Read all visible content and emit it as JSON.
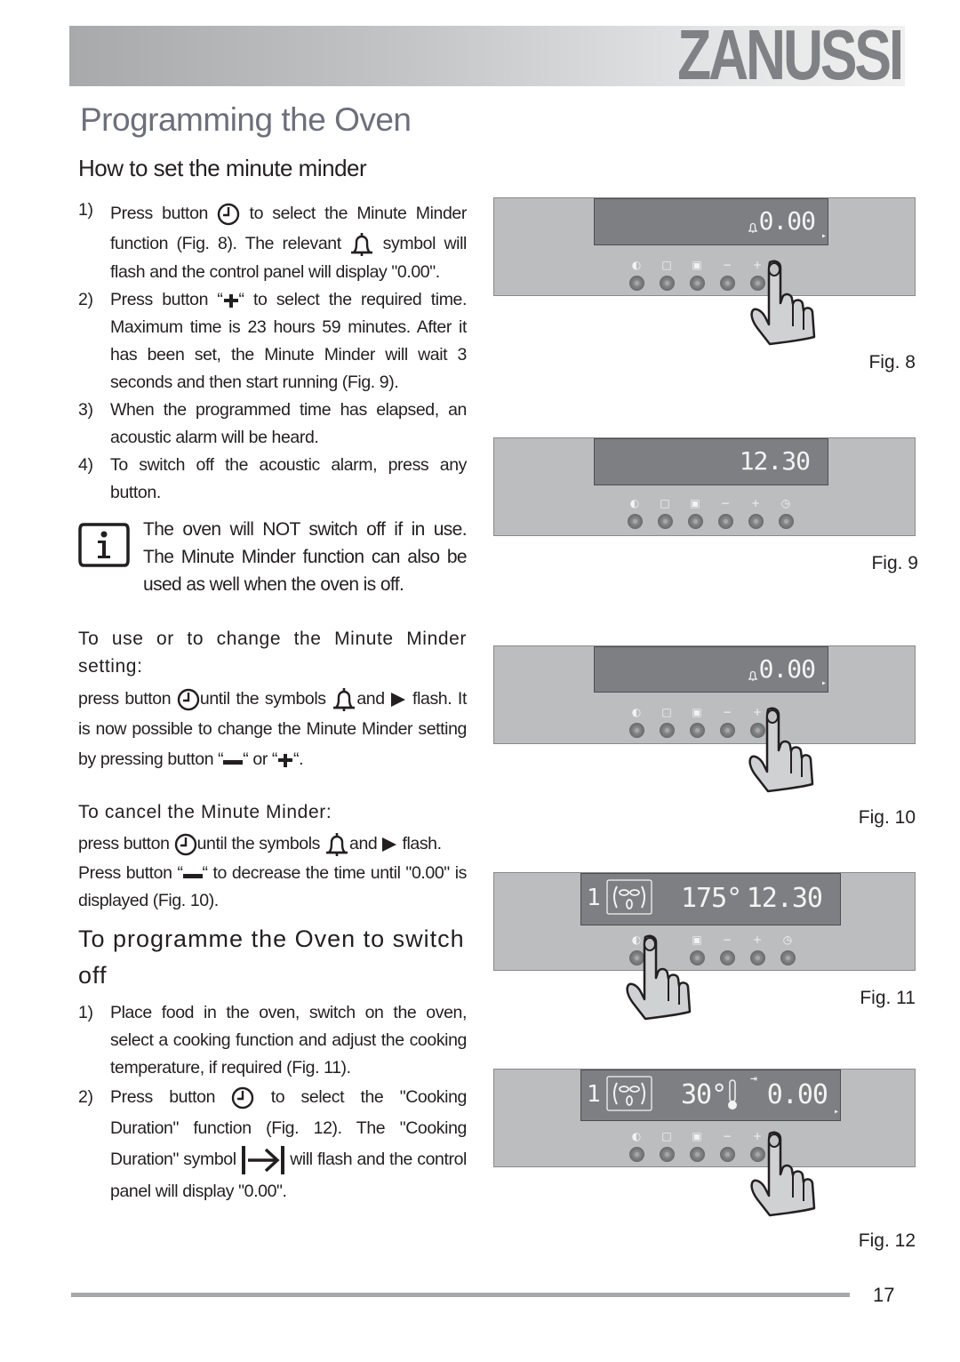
{
  "header": {
    "brand": "ZANUSSI"
  },
  "page_title": "Programming the Oven",
  "section_minute_minder": {
    "title": "How to set the minute minder",
    "steps": [
      {
        "num": "1)",
        "parts": [
          "Press button",
          "to select the Minute Minder function (Fig. 8). The relevant",
          "symbol will flash and the control panel will display \"0.00\"."
        ],
        "icons": [
          "clock-icon",
          "bell-icon"
        ]
      },
      {
        "num": "2)",
        "parts": [
          "Press button “",
          "“ to select the required time. Maximum time is 23 hours 59 minutes. After it has been set, the Minute Minder will wait 3 seconds and then start running (Fig. 9)."
        ],
        "icons": [
          "plus-icon"
        ]
      },
      {
        "num": "3)",
        "text": "When the programmed time has elapsed, an acoustic alarm will be heard."
      },
      {
        "num": "4)",
        "text": "To switch off the acoustic alarm, press any button."
      }
    ],
    "note": "The oven will NOT switch off if in use. The Minute Minder function can also be used as well when the oven is off."
  },
  "section_change": {
    "title": "To use or to change the Minute Minder setting:",
    "parts": [
      "press button",
      "until the symbols",
      "and",
      "flash. It is now possible to change the Minute Minder setting by pressing button “",
      "“ or “",
      "“."
    ]
  },
  "section_cancel": {
    "title": "To cancel the Minute Minder:",
    "parts": [
      "press button",
      "until the symbols",
      "and",
      "flash."
    ],
    "parts2": [
      "Press button “",
      "“ to decrease the time until \"0.00\" is displayed (Fig. 10)."
    ]
  },
  "section_switch_off": {
    "title": "To programme the Oven to switch off",
    "steps": [
      {
        "num": "1)",
        "text": "Place food in the oven, switch on the oven, select a cooking function and adjust the cooking temperature, if required (Fig. 11)."
      },
      {
        "num": "2)",
        "parts": [
          "Press button",
          "to select the \"Cooking Duration\" function (Fig. 12). The \"Cooking Duration\" symbol",
          "will flash and the control panel will display \"0.00\"."
        ],
        "icons": [
          "clock-icon",
          "cooking-duration-icon"
        ]
      }
    ]
  },
  "figures": [
    {
      "label": "Fig. 8",
      "display": {
        "bell": true,
        "time": "0.00",
        "arrow": true
      },
      "buttons": [
        "◐",
        "□",
        "▣",
        "−",
        "+"
      ],
      "pressed": "clock"
    },
    {
      "label": "Fig. 9",
      "display": {
        "time": "12.30"
      },
      "buttons": [
        "◐",
        "□",
        "▣",
        "−",
        "+",
        "◷"
      ]
    },
    {
      "label": "Fig. 10",
      "display": {
        "bell": true,
        "time": "0.00",
        "arrow": true
      },
      "buttons": [
        "◐",
        "□",
        "▣",
        "−",
        "+"
      ],
      "pressed": "clock"
    },
    {
      "label": "Fig. 11",
      "display": {
        "function_num": "1",
        "temperature": "175°",
        "time": "12.30"
      },
      "buttons": [
        "◐",
        "",
        "▣",
        "−",
        "+",
        "◷"
      ],
      "pressed": "function"
    },
    {
      "label": "Fig. 12",
      "display": {
        "function_num": "1",
        "temperature": "30°",
        "duration_symbol": "⇥",
        "time": "0.00",
        "arrow": true
      },
      "buttons": [
        "◐",
        "□",
        "▣",
        "−",
        "+"
      ],
      "pressed": "clock"
    }
  ],
  "footer": {
    "page_number": "17"
  }
}
